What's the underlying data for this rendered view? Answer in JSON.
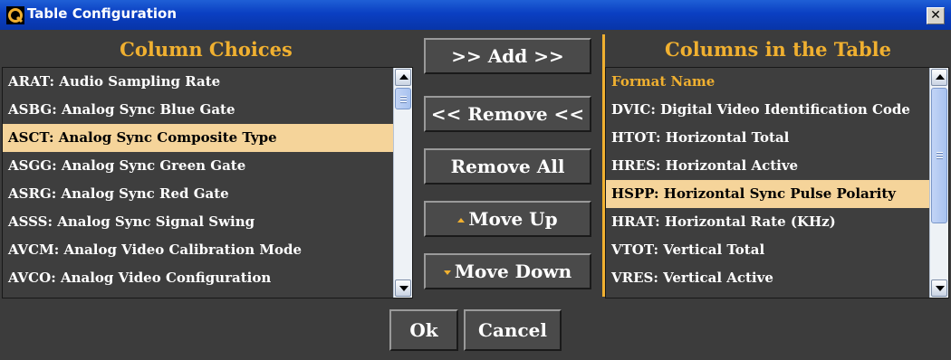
{
  "window": {
    "title": "Table Configuration",
    "close_glyph": "✕"
  },
  "left": {
    "heading": "Column Choices",
    "items": [
      {
        "label": "ARAT: Audio Sampling Rate"
      },
      {
        "label": "ASBG: Analog Sync Blue Gate"
      },
      {
        "label": "ASCT: Analog Sync Composite Type"
      },
      {
        "label": "ASGG: Analog Sync Green Gate"
      },
      {
        "label": "ASRG: Analog Sync Red Gate"
      },
      {
        "label": "ASSS: Analog Sync Signal Swing"
      },
      {
        "label": "AVCM: Analog Video Calibration Mode"
      },
      {
        "label": "AVCO: Analog Video Configuration"
      }
    ],
    "selected_index": 2
  },
  "right": {
    "heading": "Columns in the Table",
    "items": [
      {
        "label": "Format Name"
      },
      {
        "label": "DVIC: Digital Video Identification Code"
      },
      {
        "label": "HTOT: Horizontal Total"
      },
      {
        "label": "HRES: Horizontal Active"
      },
      {
        "label": "HSPP: Horizontal Sync Pulse Polarity"
      },
      {
        "label": "HRAT: Horizontal Rate (KHz)"
      },
      {
        "label": "VTOT: Vertical Total"
      },
      {
        "label": "VRES: Vertical Active"
      }
    ],
    "selected_index": 4,
    "highlight_index": 0
  },
  "buttons": {
    "add": ">> Add >>",
    "remove": "<< Remove <<",
    "remove_all": "Remove All",
    "move_up": "Move Up",
    "move_down": "Move Down"
  },
  "footer": {
    "ok": "Ok",
    "cancel": "Cancel"
  },
  "colors": {
    "accent": "#f0b030",
    "panel": "#3e3e3e",
    "selection": "#f5d49a",
    "titlebar": "#0a3fc2"
  }
}
